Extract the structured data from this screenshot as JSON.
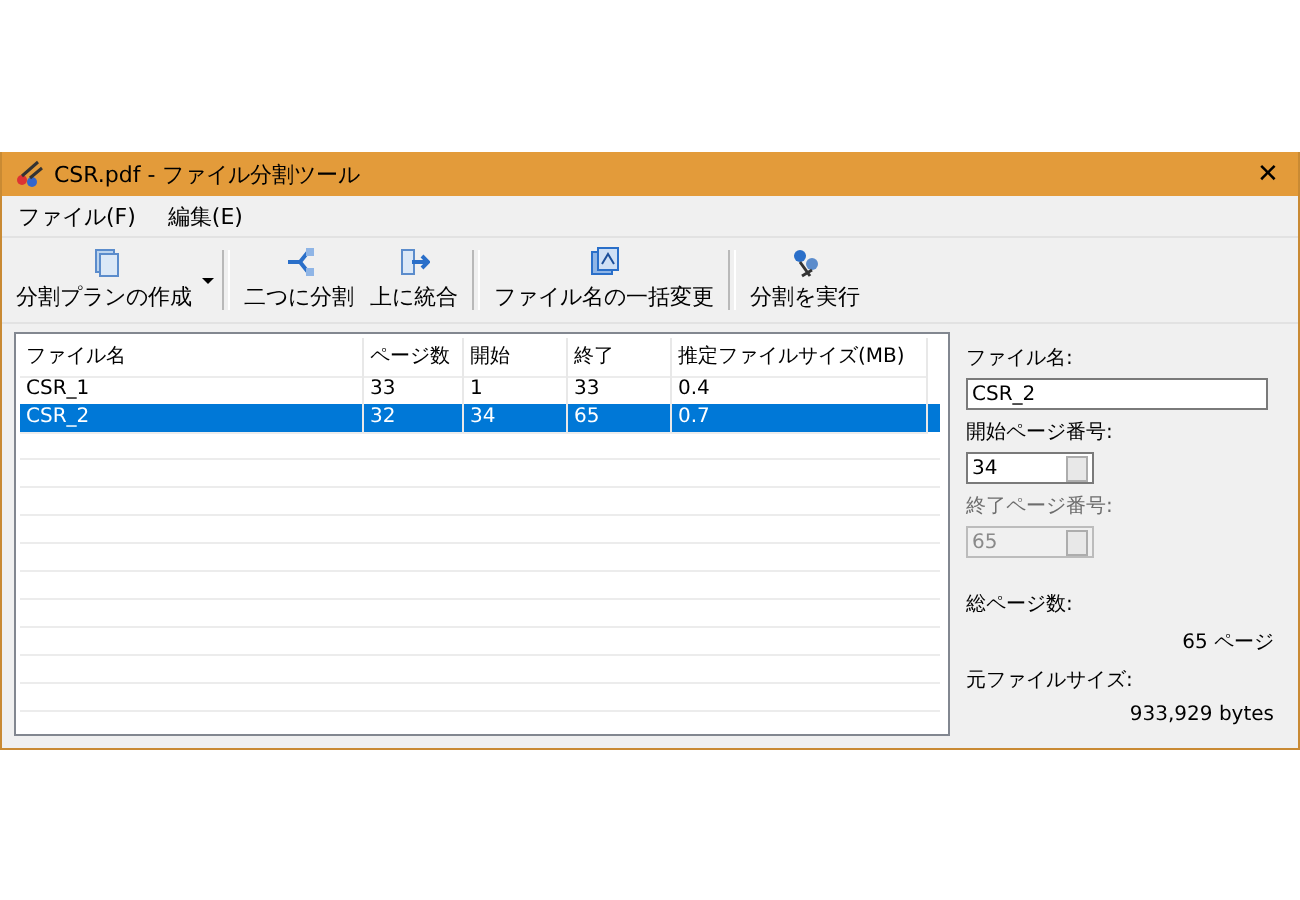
{
  "window": {
    "title": "CSR.pdf - ファイル分割ツール",
    "close": "✕"
  },
  "menu": [
    {
      "label": "ファイル(F)"
    },
    {
      "label": "編集(E)"
    }
  ],
  "toolbar": [
    {
      "label": "分割プランの作成",
      "dropdown": true,
      "group_start": false
    },
    {
      "label": "二つに分割",
      "dropdown": false,
      "group_start": true
    },
    {
      "label": "上に統合",
      "dropdown": false,
      "group_start": false
    },
    {
      "label": "ファイル名の一括変更",
      "dropdown": false,
      "group_start": true
    },
    {
      "label": "分割を実行",
      "dropdown": false,
      "group_start": true
    }
  ],
  "table": {
    "columns": [
      "ファイル名",
      "ページ数",
      "開始",
      "終了",
      "推定ファイルサイズ(MB)"
    ],
    "rows": [
      {
        "cells": [
          "CSR_1",
          "33",
          "1",
          "33",
          "0.4"
        ],
        "selected": false
      },
      {
        "cells": [
          "CSR_2",
          "32",
          "34",
          "65",
          "0.7"
        ],
        "selected": true
      }
    ]
  },
  "details": {
    "fields": [
      {
        "label": "ファイル名:",
        "kind": "text",
        "value": "CSR_2",
        "disabled": false
      },
      {
        "label": "開始ページ番号:",
        "kind": "spin",
        "value": "34",
        "disabled": false
      },
      {
        "label": "終了ページ番号:",
        "kind": "spin",
        "value": "65",
        "disabled": true
      }
    ],
    "stats": [
      {
        "label": "総ページ数:",
        "value": "65 ページ"
      },
      {
        "label": "元ファイルサイズ:",
        "value": "933,929 bytes"
      }
    ]
  }
}
